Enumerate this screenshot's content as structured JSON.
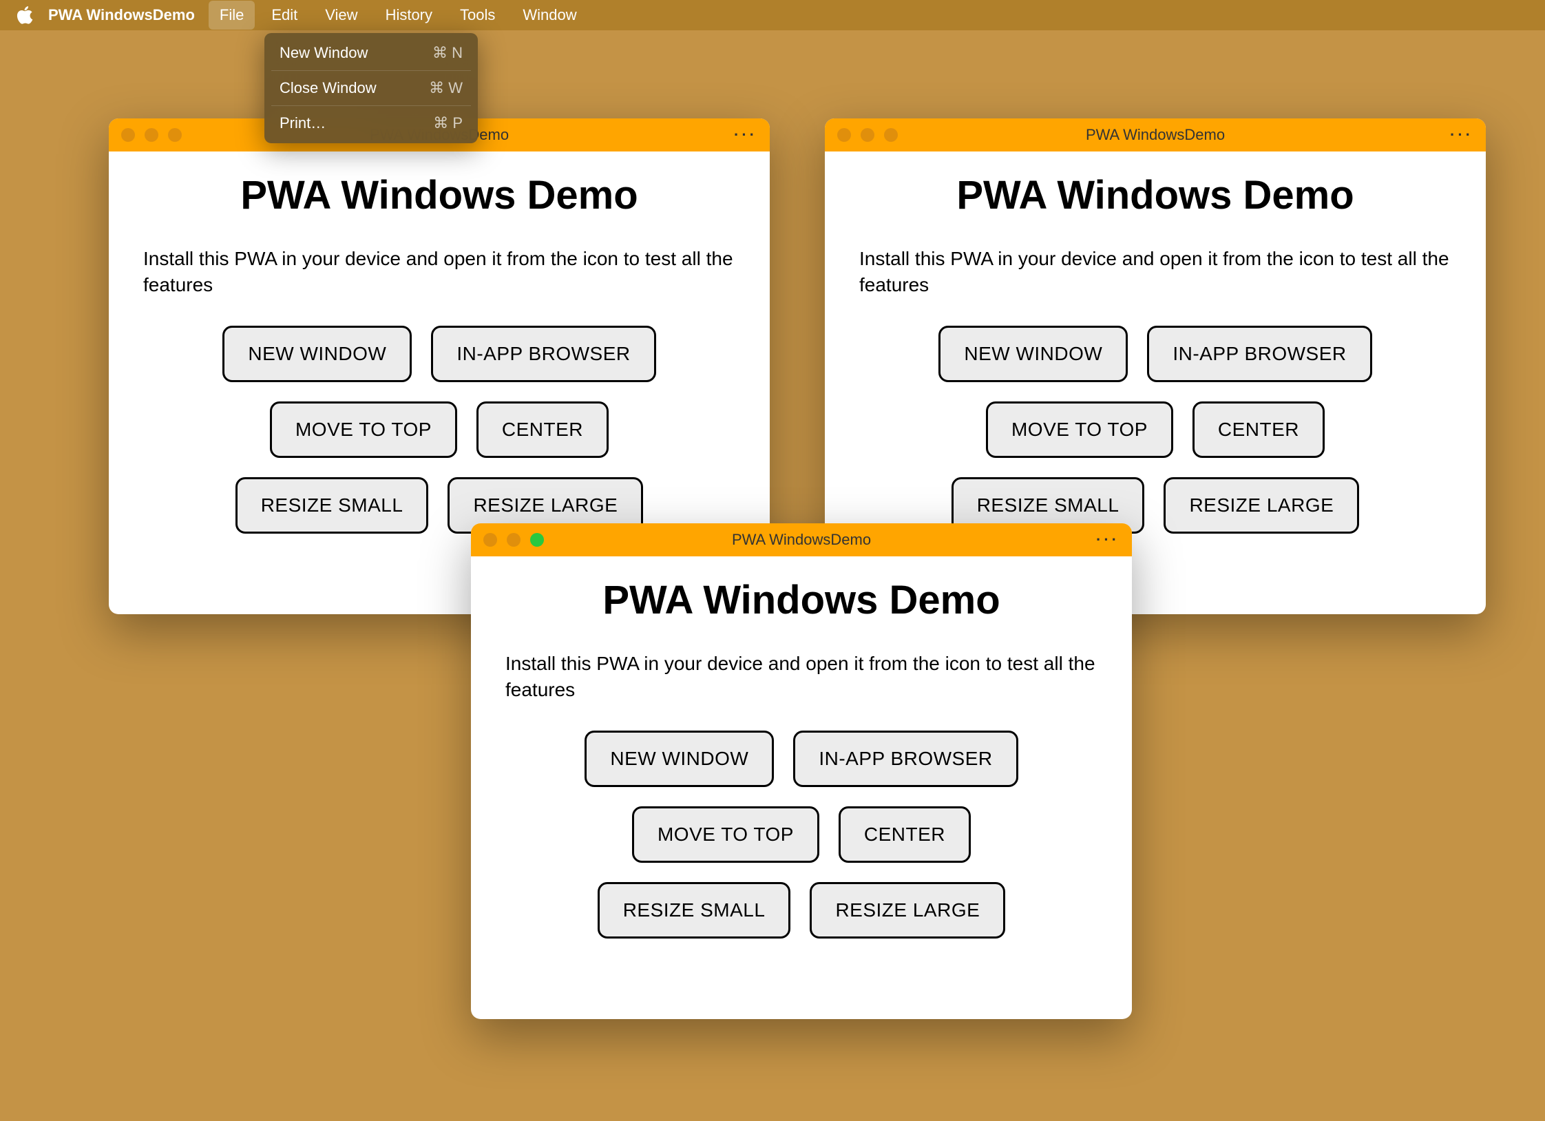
{
  "menubar": {
    "app_name": "PWA WindowsDemo",
    "items": [
      "File",
      "Edit",
      "View",
      "History",
      "Tools",
      "Window"
    ],
    "active_index": 0
  },
  "dropdown": {
    "items": [
      {
        "label": "New Window",
        "shortcut": "⌘ N"
      },
      {
        "divider": true
      },
      {
        "label": "Close Window",
        "shortcut": "⌘ W"
      },
      {
        "divider": true
      },
      {
        "label": "Print…",
        "shortcut": "⌘ P"
      }
    ]
  },
  "app": {
    "titlebar_title": "PWA WindowsDemo",
    "heading": "PWA Windows Demo",
    "paragraph": "Install this PWA in your device and open it from the icon to test all the features",
    "buttons": {
      "new_window": "NEW WINDOW",
      "in_app_browser": "IN-APP BROWSER",
      "move_to_top": "MOVE TO TOP",
      "center": "CENTER",
      "resize_small": "RESIZE SMALL",
      "resize_large": "RESIZE LARGE"
    },
    "more_icon": "···"
  },
  "windows": [
    {
      "active": false
    },
    {
      "active": false
    },
    {
      "active": true
    }
  ]
}
